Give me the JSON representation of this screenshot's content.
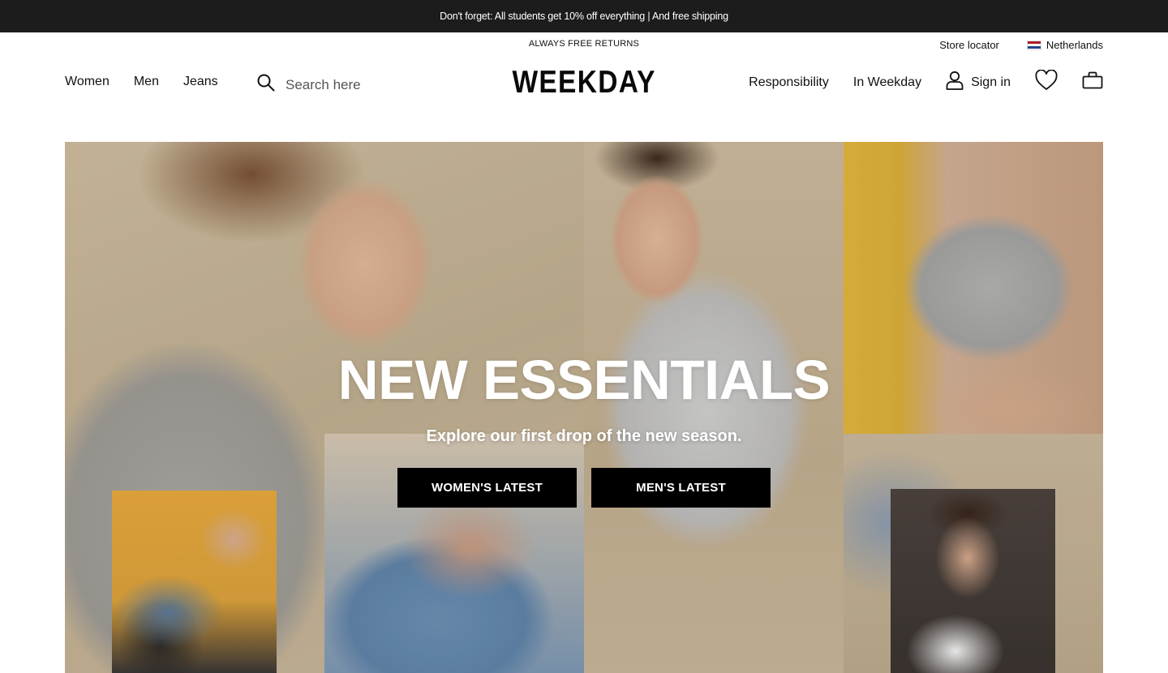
{
  "promo": {
    "text": "Don't forget: All students get 10% off everything | And free shipping"
  },
  "header": {
    "returns": "ALWAYS FREE RETURNS",
    "store_locator": "Store locator",
    "country": "Netherlands",
    "logo": "WEEKDAY",
    "nav_left": [
      "Women",
      "Men",
      "Jeans"
    ],
    "search_placeholder": "Search here",
    "nav_right": {
      "responsibility": "Responsibility",
      "in_weekday": "In Weekday",
      "sign_in": "Sign in"
    },
    "icons": {
      "search": "search-icon",
      "user": "user-icon",
      "wishlist": "heart-icon",
      "bag": "bag-icon",
      "flag": "netherlands-flag-icon"
    }
  },
  "hero": {
    "title": "NEW ESSENTIALS",
    "subtitle": "Explore our first drop of the new season.",
    "cta_women": "WOMEN'S LATEST",
    "cta_men": "MEN'S LATEST"
  },
  "colors": {
    "promo_bg": "#1c1c1c",
    "cta_bg": "#000000",
    "text": "#111111"
  }
}
